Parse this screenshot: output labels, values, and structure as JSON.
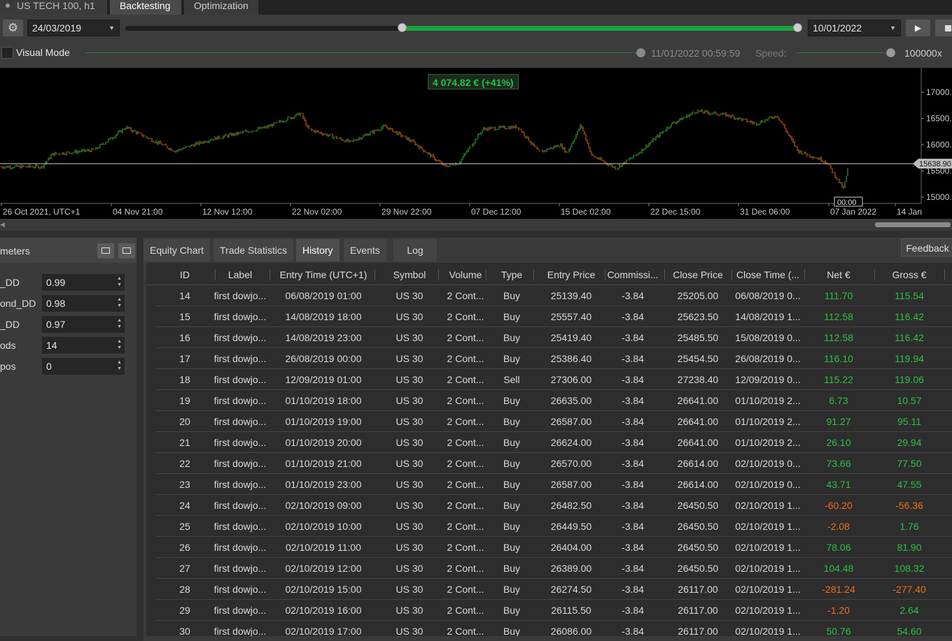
{
  "tabs": {
    "symbol": "US TECH 100, h1",
    "backtesting": "Backtesting",
    "optimization": "Optimization"
  },
  "controls": {
    "start_date": "24/03/2019",
    "end_date": "10/01/2022",
    "visual_mode_label": "Visual Mode",
    "visual_time": "11/01/2022 00:59:59",
    "speed_label": "Speed:",
    "speed_value": "100000x"
  },
  "chart": {
    "equity_badge": "4 074.82 € (+41%)",
    "price_label": "15638.90",
    "cursor_time": "00:00",
    "y_ticks": [
      "17000.",
      "16500.",
      "16000.",
      "15500.",
      "15000."
    ],
    "x_ticks": [
      "26 Oct 2021, UTC+1",
      "04 Nov 21:00",
      "12 Nov 12:00",
      "22 Nov 02:00",
      "29 Nov 22:00",
      "07 Dec 12:00",
      "15 Dec 02:00",
      "22 Dec 15:00",
      "31 Dec 06:00",
      "07 Jan 2022",
      "14 Jan"
    ]
  },
  "params": {
    "title": "meters",
    "rows": [
      {
        "label": "_DD",
        "value": "0.99"
      },
      {
        "label": "ond_DD",
        "value": "0.98"
      },
      {
        "label": "_DD",
        "value": "0.97"
      },
      {
        "label": "ods",
        "value": "14"
      },
      {
        "label": "pos",
        "value": "0"
      }
    ]
  },
  "result_tabs": [
    "Equity Chart",
    "Trade Statistics",
    "History",
    "Events",
    "Log"
  ],
  "feedback_label": "Feedback",
  "table": {
    "columns": [
      "ID",
      "Label",
      "Entry Time (UTC+1)",
      "Symbol",
      "Volume",
      "Type",
      "Entry Price",
      "Commissi...",
      "Close Price",
      "Close Time (...",
      "Net €",
      "Gross €"
    ],
    "rows": [
      [
        "14",
        "first dowjo...",
        "06/08/2019 01:00",
        "US 30",
        "2 Cont...",
        "Buy",
        "25139.40",
        "-3.84",
        "25205.00",
        "06/08/2019 0...",
        "111.70",
        "115.54"
      ],
      [
        "15",
        "first dowjo...",
        "14/08/2019 18:00",
        "US 30",
        "2 Cont...",
        "Buy",
        "25557.40",
        "-3.84",
        "25623.50",
        "14/08/2019 1...",
        "112.58",
        "116.42"
      ],
      [
        "16",
        "first dowjo...",
        "14/08/2019 23:00",
        "US 30",
        "2 Cont...",
        "Buy",
        "25419.40",
        "-3.84",
        "25485.50",
        "15/08/2019 0...",
        "112.58",
        "116.42"
      ],
      [
        "17",
        "first dowjo...",
        "26/08/2019 00:00",
        "US 30",
        "2 Cont...",
        "Buy",
        "25386.40",
        "-3.84",
        "25454.50",
        "26/08/2019 0...",
        "116.10",
        "119.94"
      ],
      [
        "18",
        "first dowjo...",
        "12/09/2019 01:00",
        "US 30",
        "2 Cont...",
        "Sell",
        "27306.00",
        "-3.84",
        "27238.40",
        "12/09/2019 0...",
        "115.22",
        "119.06"
      ],
      [
        "19",
        "first dowjo...",
        "01/10/2019 18:00",
        "US 30",
        "2 Cont...",
        "Buy",
        "26635.00",
        "-3.84",
        "26641.00",
        "01/10/2019 2...",
        "6.73",
        "10.57"
      ],
      [
        "20",
        "first dowjo...",
        "01/10/2019 19:00",
        "US 30",
        "2 Cont...",
        "Buy",
        "26587.00",
        "-3.84",
        "26641.00",
        "01/10/2019 2...",
        "91.27",
        "95.11"
      ],
      [
        "21",
        "first dowjo...",
        "01/10/2019 20:00",
        "US 30",
        "2 Cont...",
        "Buy",
        "26624.00",
        "-3.84",
        "26641.00",
        "01/10/2019 2...",
        "26.10",
        "29.94"
      ],
      [
        "22",
        "first dowjo...",
        "01/10/2019 21:00",
        "US 30",
        "2 Cont...",
        "Buy",
        "26570.00",
        "-3.84",
        "26614.00",
        "02/10/2019 0...",
        "73.66",
        "77.50"
      ],
      [
        "23",
        "first dowjo...",
        "01/10/2019 23:00",
        "US 30",
        "2 Cont...",
        "Buy",
        "26587.00",
        "-3.84",
        "26614.00",
        "02/10/2019 0...",
        "43.71",
        "47.55"
      ],
      [
        "24",
        "first dowjo...",
        "02/10/2019 09:00",
        "US 30",
        "2 Cont...",
        "Buy",
        "26482.50",
        "-3.84",
        "26450.50",
        "02/10/2019 1...",
        "-60.20",
        "-56.36"
      ],
      [
        "25",
        "first dowjo...",
        "02/10/2019 10:00",
        "US 30",
        "2 Cont...",
        "Buy",
        "26449.50",
        "-3.84",
        "26450.50",
        "02/10/2019 1...",
        "-2.08",
        "1.76"
      ],
      [
        "26",
        "first dowjo...",
        "02/10/2019 11:00",
        "US 30",
        "2 Cont...",
        "Buy",
        "26404.00",
        "-3.84",
        "26450.50",
        "02/10/2019 1...",
        "78.06",
        "81.90"
      ],
      [
        "27",
        "first dowjo...",
        "02/10/2019 12:00",
        "US 30",
        "2 Cont...",
        "Buy",
        "26389.00",
        "-3.84",
        "26450.50",
        "02/10/2019 1...",
        "104.48",
        "108.32"
      ],
      [
        "28",
        "first dowjo...",
        "02/10/2019 15:00",
        "US 30",
        "2 Cont...",
        "Buy",
        "26274.50",
        "-3.84",
        "26117.00",
        "02/10/2019 1...",
        "-281.24",
        "-277.40"
      ],
      [
        "29",
        "first dowjo...",
        "02/10/2019 16:00",
        "US 30",
        "2 Cont...",
        "Buy",
        "26115.50",
        "-3.84",
        "26117.00",
        "02/10/2019 1...",
        "-1.20",
        "2.64"
      ],
      [
        "30",
        "first dowjo...",
        "02/10/2019 17:00",
        "US 30",
        "2 Cont...",
        "Buy",
        "26086.00",
        "-3.84",
        "26117.00",
        "02/10/2019 1...",
        "50.76",
        "54.60"
      ]
    ]
  },
  "colors": {
    "positive": "#2fbf45",
    "negative": "#f26b1d",
    "accent_green": "#18a33b"
  }
}
